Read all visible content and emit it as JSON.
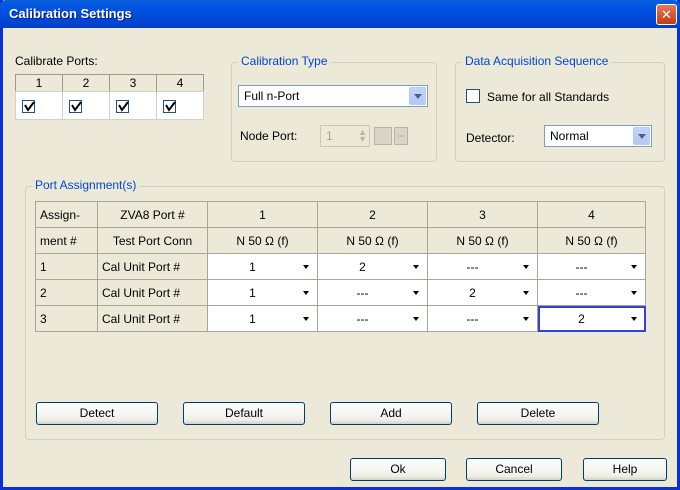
{
  "window": {
    "title": "Calibration Settings",
    "close_glyph": "✕"
  },
  "calibrate_ports": {
    "label": "Calibrate Ports:",
    "ports": [
      {
        "num": "1",
        "checked": true
      },
      {
        "num": "2",
        "checked": true
      },
      {
        "num": "3",
        "checked": true
      },
      {
        "num": "4",
        "checked": true
      }
    ]
  },
  "calibration_type": {
    "group_title": "Calibration Type",
    "selected": "Full n-Port",
    "node_port_label": "Node Port:",
    "node_port_value": "1"
  },
  "data_acquisition": {
    "group_title": "Data Acquisition Sequence",
    "same_for_all_label": "Same for all Standards",
    "same_for_all_checked": false,
    "detector_label": "Detector:",
    "detector_value": "Normal"
  },
  "port_assignment": {
    "group_title": "Port Assignment(s)",
    "header1": [
      "Assign-",
      "ZVA8 Port #",
      "1",
      "2",
      "3",
      "4"
    ],
    "header2": [
      "ment #",
      "Test Port Conn",
      "N 50 Ω (f)",
      "N 50 Ω (f)",
      "N 50 Ω (f)",
      "N 50 Ω (f)"
    ],
    "rows": [
      {
        "num": "1",
        "label": "Cal Unit Port #",
        "cells": [
          "1",
          "2",
          "---",
          "---"
        ]
      },
      {
        "num": "2",
        "label": "Cal Unit Port #",
        "cells": [
          "1",
          "---",
          "2",
          "---"
        ]
      },
      {
        "num": "3",
        "label": "Cal Unit Port #",
        "cells": [
          "1",
          "---",
          "---",
          "2"
        ]
      }
    ],
    "buttons": {
      "detect": "Detect",
      "default": "Default",
      "add": "Add",
      "delete": "Delete"
    }
  },
  "footer_buttons": {
    "ok": "Ok",
    "cancel": "Cancel",
    "help": "Help"
  },
  "colors": {
    "title_bar": "#0054e3",
    "group_title": "#0046d5",
    "dialog_bg": "#ece9d8"
  }
}
